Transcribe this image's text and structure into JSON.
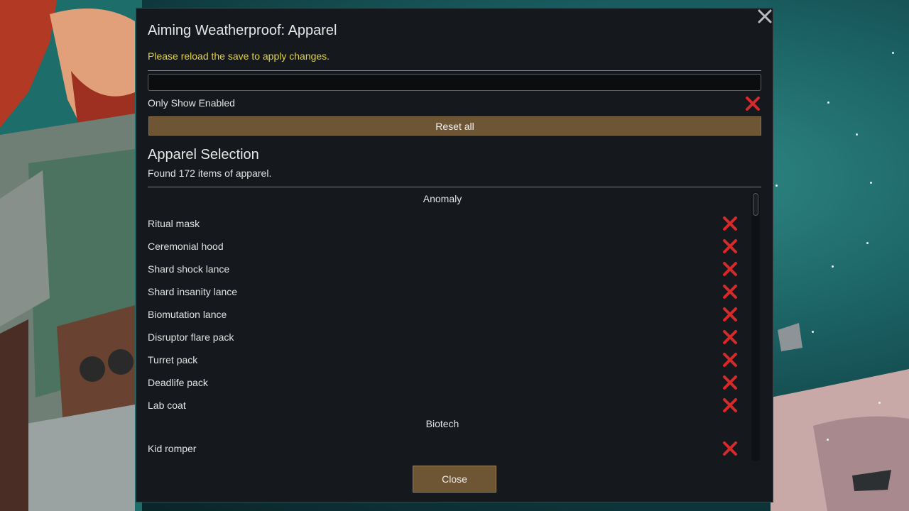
{
  "dialog": {
    "title": "Aiming Weatherproof: Apparel",
    "notice": "Please reload the save to apply changes.",
    "search": {
      "value": "",
      "placeholder": ""
    },
    "only_show_enabled": {
      "label": "Only Show Enabled",
      "checked": false
    },
    "reset_label": "Reset all",
    "section_title": "Apparel Selection",
    "found_text": "Found 172 items of apparel.",
    "categories": [
      {
        "name": "Anomaly",
        "items": [
          {
            "name": "Ritual mask",
            "enabled": false
          },
          {
            "name": "Ceremonial hood",
            "enabled": false
          },
          {
            "name": "Shard shock lance",
            "enabled": false
          },
          {
            "name": "Shard insanity lance",
            "enabled": false
          },
          {
            "name": "Biomutation lance",
            "enabled": false
          },
          {
            "name": "Disruptor flare pack",
            "enabled": false
          },
          {
            "name": "Turret pack",
            "enabled": false
          },
          {
            "name": "Deadlife pack",
            "enabled": false
          },
          {
            "name": "Lab coat",
            "enabled": false
          }
        ]
      },
      {
        "name": "Biotech",
        "items": [
          {
            "name": "Kid romper",
            "enabled": false
          }
        ]
      }
    ],
    "close_label": "Close"
  },
  "icons": {
    "close_window": "close-icon",
    "disabled_mark": "red-x-icon"
  },
  "colors": {
    "accent_gold": "#6e5533",
    "notice_yellow": "#e4d23c",
    "x_red": "#d62a2a",
    "panel_bg": "#15191d"
  }
}
